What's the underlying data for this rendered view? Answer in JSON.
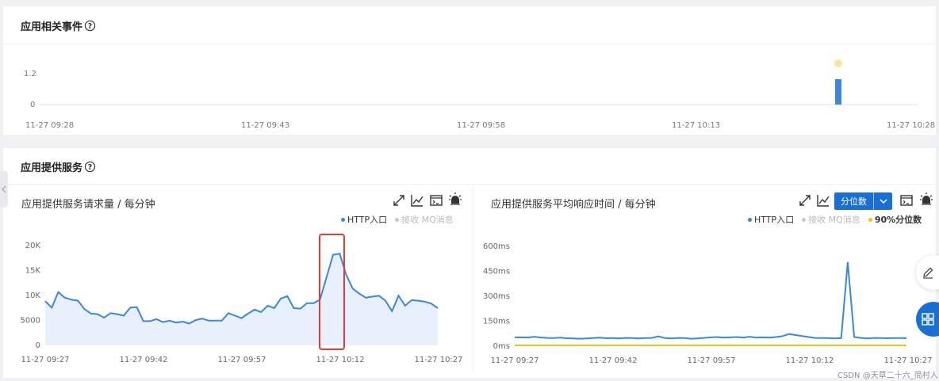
{
  "events_section": {
    "title": "应用相关事件",
    "chart_data": {
      "type": "bar",
      "y_ticks": [
        "1.2",
        "0"
      ],
      "x_ticks": [
        "11-27 09:28",
        "11-27 09:43",
        "11-27 09:58",
        "11-27 10:13",
        "11-27 10:28"
      ],
      "bars": [
        {
          "time": "11-27 10:21",
          "value": 1
        }
      ],
      "bar_color": "#3b87e0",
      "marker_color": "#fbe3a2"
    }
  },
  "services_section": {
    "title": "应用提供服务",
    "left_panel": {
      "title": "应用提供服务请求量 / 每分钟",
      "legend": [
        {
          "label": "HTTP入口",
          "color": "#3b87e0",
          "active": true
        },
        {
          "label": "接收 MQ消息",
          "color": "#c8c8c8",
          "active": false
        }
      ],
      "chart_data": {
        "type": "area",
        "y_ticks": [
          "20K",
          "15K",
          "10K",
          "5000",
          "0"
        ],
        "ylim": [
          0,
          20000
        ],
        "x_ticks": [
          "11-27 09:27",
          "11-27 09:42",
          "11-27 09:57",
          "11-27 10:12",
          "11-27 10:27"
        ],
        "series": [
          {
            "name": "HTTP入口",
            "values": [
              8700,
              7400,
              10500,
              9400,
              9000,
              8800,
              7100,
              6200,
              6100,
              5400,
              6300,
              6100,
              5800,
              7400,
              7500,
              4700,
              4700,
              5100,
              4500,
              4800,
              4400,
              4600,
              4200,
              4900,
              5200,
              4800,
              4800,
              4800,
              6300,
              5800,
              5300,
              6200,
              7000,
              6500,
              7800,
              7300,
              9200,
              9700,
              7300,
              7200,
              8300,
              8300,
              9000,
              13500,
              18000,
              18200,
              14000,
              11200,
              10200,
              9400,
              9600,
              9800,
              8800,
              6700,
              9800,
              7800,
              8900,
              8800,
              8600,
              8200,
              7300
            ]
          }
        ],
        "line_color": "#3b87e0",
        "fill_color": "#e8f1fb",
        "highlight_box_color": "#e53935"
      }
    },
    "right_panel": {
      "title": "应用提供服务平均响应时间 / 每分钟",
      "select_label": "分位数",
      "legend": [
        {
          "label": "HTTP入口",
          "color": "#3b87e0",
          "active": true
        },
        {
          "label": "接收 MQ消息",
          "color": "#c8c8c8",
          "active": false
        },
        {
          "label": "90%分位数",
          "color": "#f2c21b",
          "active": true
        }
      ],
      "chart_data": {
        "type": "line",
        "y_ticks": [
          "600ms",
          "450ms",
          "300ms",
          "150ms",
          "0ms"
        ],
        "ylim": [
          0,
          600
        ],
        "x_ticks": [
          "11-27 09:27",
          "11-27 09:42",
          "11-27 09:57",
          "11-27 10:12",
          "11-27 10:27"
        ],
        "series": [
          {
            "name": "HTTP入口",
            "values": [
              48,
              48,
              47,
              52,
              47,
              45,
              44,
              46,
              43,
              42,
              40,
              42,
              44,
              46,
              43,
              44,
              42,
              45,
              44,
              42,
              44,
              45,
              54,
              44,
              42,
              45,
              44,
              40,
              42,
              45,
              48,
              50,
              46,
              48,
              50,
              47,
              52,
              46,
              48,
              46,
              50,
              55,
              68,
              62,
              56,
              50,
              45,
              44,
              44,
              42,
              44,
              500,
              50,
              45,
              42,
              45,
              44,
              43,
              44,
              44,
              43
            ],
            "color": "#3b87e0"
          },
          {
            "name": "90%分位数",
            "values": [
              0,
              0,
              0,
              0,
              0,
              0,
              0,
              0,
              0,
              0,
              0,
              0,
              0,
              0,
              0,
              0,
              0,
              0,
              0,
              0,
              0,
              0,
              0,
              0,
              0,
              0,
              0,
              0,
              0,
              0,
              0,
              0,
              0,
              0,
              0,
              0,
              0,
              0,
              0,
              0,
              0,
              0,
              0,
              0,
              0,
              0,
              0,
              0,
              0,
              0,
              0,
              0,
              0,
              0,
              0,
              0,
              0,
              0,
              0,
              0,
              0
            ],
            "color": "#f2c21b"
          }
        ]
      }
    }
  },
  "watermark": "CSDN @天草二十六_简村人"
}
